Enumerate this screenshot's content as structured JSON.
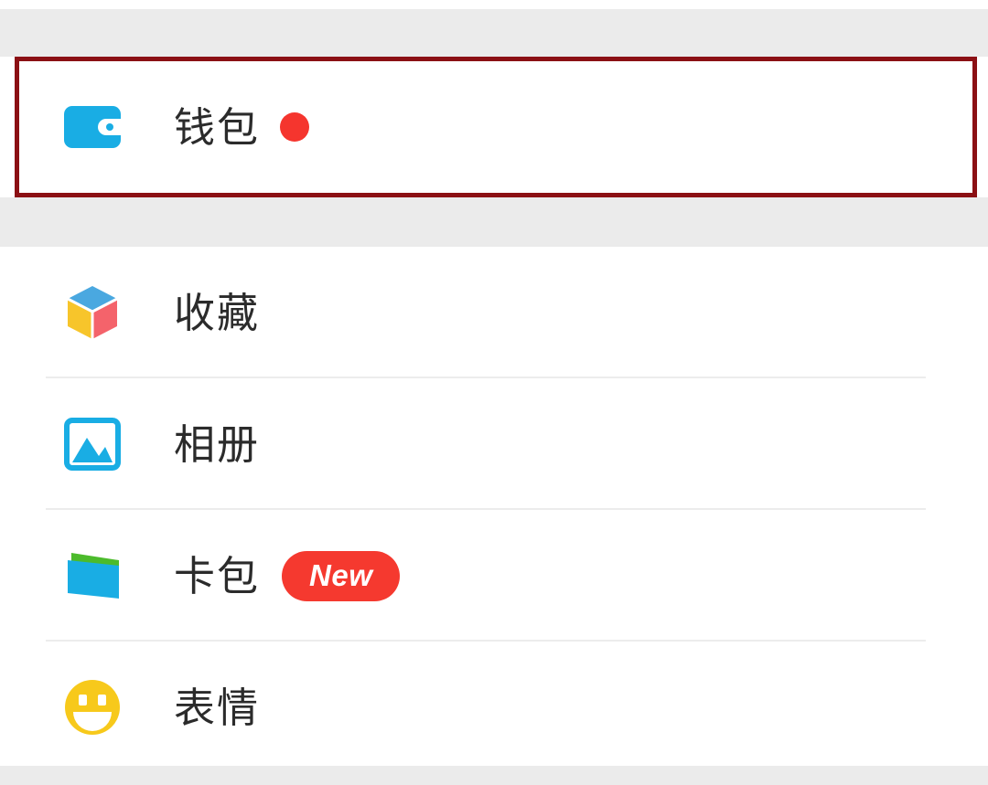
{
  "screen": {
    "title": "WeChat Me Menu",
    "background_color": "#ebebeb",
    "card_color": "#ffffff"
  },
  "highlight": {
    "name": "wallet-row-highlight",
    "color": "#8b1014",
    "border_width_px": 5,
    "target_label": "钱包"
  },
  "wallet_section": {
    "item": {
      "label": "钱包",
      "icon": "wallet-icon",
      "icon_color": "#19ade4",
      "badge_type": "dot",
      "badge_color": "#f5352e"
    }
  },
  "list_section": {
    "items": [
      {
        "label": "收藏",
        "icon": "favorites-cube-icon",
        "icon_colors": [
          "#4aa8e0",
          "#f7c52b",
          "#f4636b"
        ],
        "badge_type": "none",
        "badge_text": ""
      },
      {
        "label": "相册",
        "icon": "photo-album-icon",
        "icon_colors": [
          "#19ade4"
        ],
        "badge_type": "none",
        "badge_text": ""
      },
      {
        "label": "卡包",
        "icon": "card-package-icon",
        "icon_colors": [
          "#19ade4",
          "#4cbb2c"
        ],
        "badge_type": "pill",
        "badge_text": "New",
        "badge_color": "#f5392f"
      },
      {
        "label": "表情",
        "icon": "emoji-smiley-icon",
        "icon_colors": [
          "#f7c91b"
        ],
        "badge_type": "none",
        "badge_text": ""
      }
    ]
  }
}
